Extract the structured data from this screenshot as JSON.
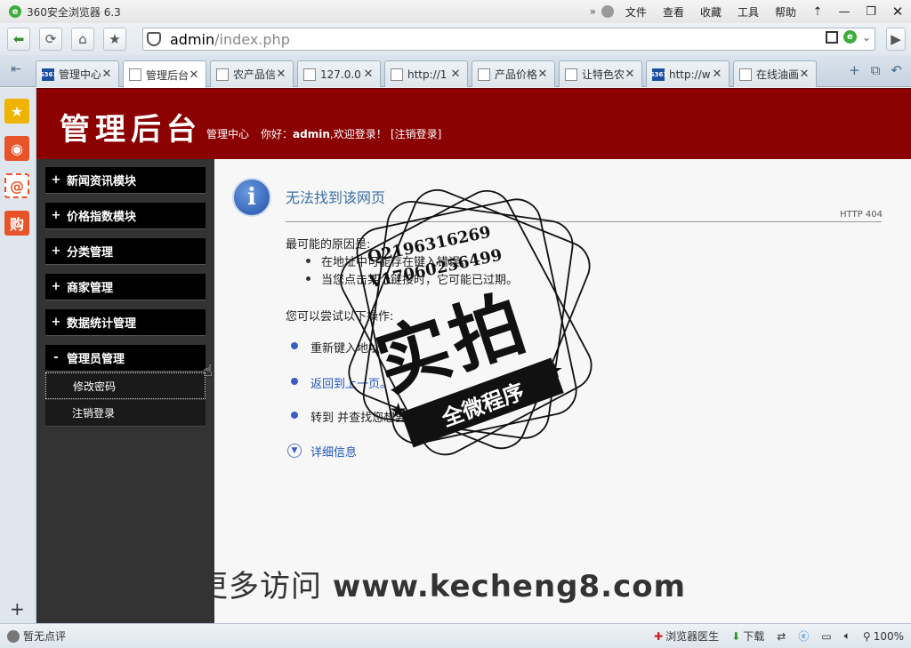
{
  "window": {
    "app_title": "360安全浏览器 6.3",
    "menu": [
      "文件",
      "查看",
      "收藏",
      "工具",
      "帮助"
    ]
  },
  "address": {
    "host": "admin",
    "path": "/index.php"
  },
  "tabs": [
    {
      "label": "管理中心",
      "favicon": "G361",
      "active": false
    },
    {
      "label": "管理后台",
      "favicon": "doc",
      "active": true
    },
    {
      "label": "农产品信",
      "favicon": "doc",
      "active": false
    },
    {
      "label": "127.0.0.",
      "favicon": "doc",
      "active": false
    },
    {
      "label": "http://1",
      "favicon": "doc",
      "active": false
    },
    {
      "label": "产品价格",
      "favicon": "doc",
      "active": false
    },
    {
      "label": "让特色农",
      "favicon": "doc",
      "active": false
    },
    {
      "label": "http://w",
      "favicon": "G361",
      "active": false
    },
    {
      "label": "在线油画",
      "favicon": "doc",
      "active": false
    }
  ],
  "header": {
    "logo": "管理后台",
    "center_link": "管理中心",
    "greeting_prefix": "你好：",
    "username": "admin",
    "greeting_suffix": ",欢迎登录！",
    "logout": "[注销登录]"
  },
  "menu": {
    "items": [
      {
        "label": "新闻资讯模块",
        "sign": "+"
      },
      {
        "label": "价格指数模块",
        "sign": "+"
      },
      {
        "label": "分类管理",
        "sign": "+"
      },
      {
        "label": "商家管理",
        "sign": "+"
      },
      {
        "label": "数据统计管理",
        "sign": "+"
      },
      {
        "label": "管理员管理",
        "sign": "-"
      }
    ],
    "sub_items": [
      "修改密码",
      "注销登录"
    ]
  },
  "error": {
    "title": "无法找到该网页",
    "code": "HTTP 404",
    "cause_heading": "最可能的原因是:",
    "causes": [
      "在地址中可能存在键入错误。",
      "当您点击某个链接时，它可能已过期。"
    ],
    "try_heading": "您可以尝试以下操作:",
    "options": [
      {
        "label": "重新键入地址。",
        "link": false
      },
      {
        "label": "返回到上一页。",
        "link": true
      },
      {
        "label": "转到  并查找您想要的信息。",
        "link": false
      }
    ],
    "details": "详细信息"
  },
  "watermark": {
    "qq1": "Q2196316269",
    "qq2": "V17060256499",
    "stamp_big": "实拍",
    "stamp_ribbon": "全微程序",
    "site_prefix": "更多访问 ",
    "site": "www.kecheng8.com"
  },
  "status": {
    "left": "暂无点评",
    "doctor": "浏览器医生",
    "download": "下载",
    "zoom": "100%"
  }
}
